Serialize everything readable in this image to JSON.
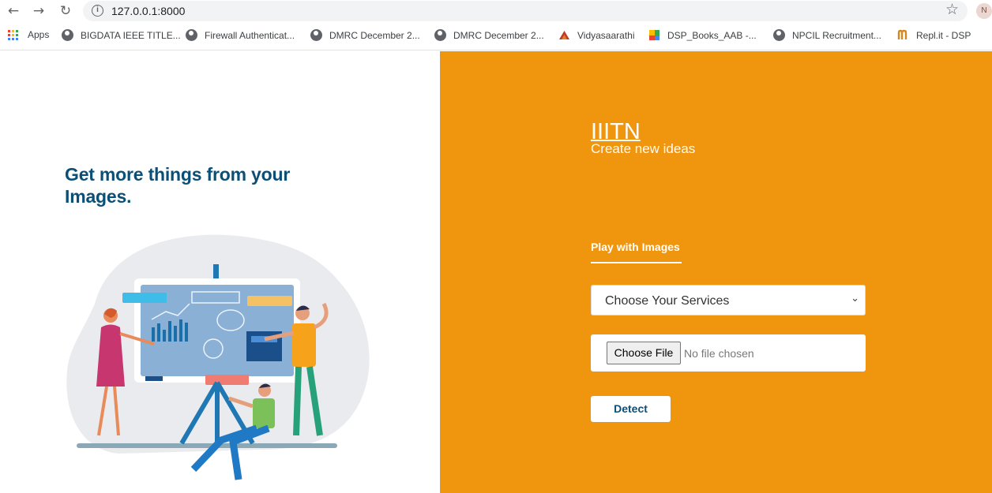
{
  "browser": {
    "url": "127.0.0.1:8000",
    "profile_initial": "N",
    "nav_glyphs": {
      "back": "←",
      "forward": "→",
      "reload": "↻",
      "star": "☆",
      "info": "i"
    },
    "bookmarks": [
      {
        "label": "Apps",
        "icon": "apps-grid-icon"
      },
      {
        "label": "BIGDATA IEEE TITLE...",
        "icon": "globe-icon"
      },
      {
        "label": "Firewall Authenticat...",
        "icon": "globe-icon"
      },
      {
        "label": "DMRC December 2...",
        "icon": "globe-icon"
      },
      {
        "label": "DMRC December 2...",
        "icon": "globe-icon"
      },
      {
        "label": "Vidyasaarathi",
        "icon": "vidyasaarathi-icon"
      },
      {
        "label": "DSP_Books_AAB -...",
        "icon": "drive-icon"
      },
      {
        "label": "NPCIL Recruitment...",
        "icon": "globe-icon"
      },
      {
        "label": "Repl.it - DSP",
        "icon": "replit-icon"
      }
    ]
  },
  "left": {
    "headline": "Get more things from your Images."
  },
  "right": {
    "brand": "IIITN",
    "tagline": "Create new ideas",
    "section_title": "Play with Images",
    "service_select": {
      "selected": "Choose Your Services",
      "chevron": "⌄"
    },
    "file_input": {
      "button_label": "Choose File",
      "status": "No file chosen"
    },
    "detect_label": "Detect"
  },
  "colors": {
    "accent_orange": "#ef960e",
    "headline_blue": "#0b4f76"
  }
}
